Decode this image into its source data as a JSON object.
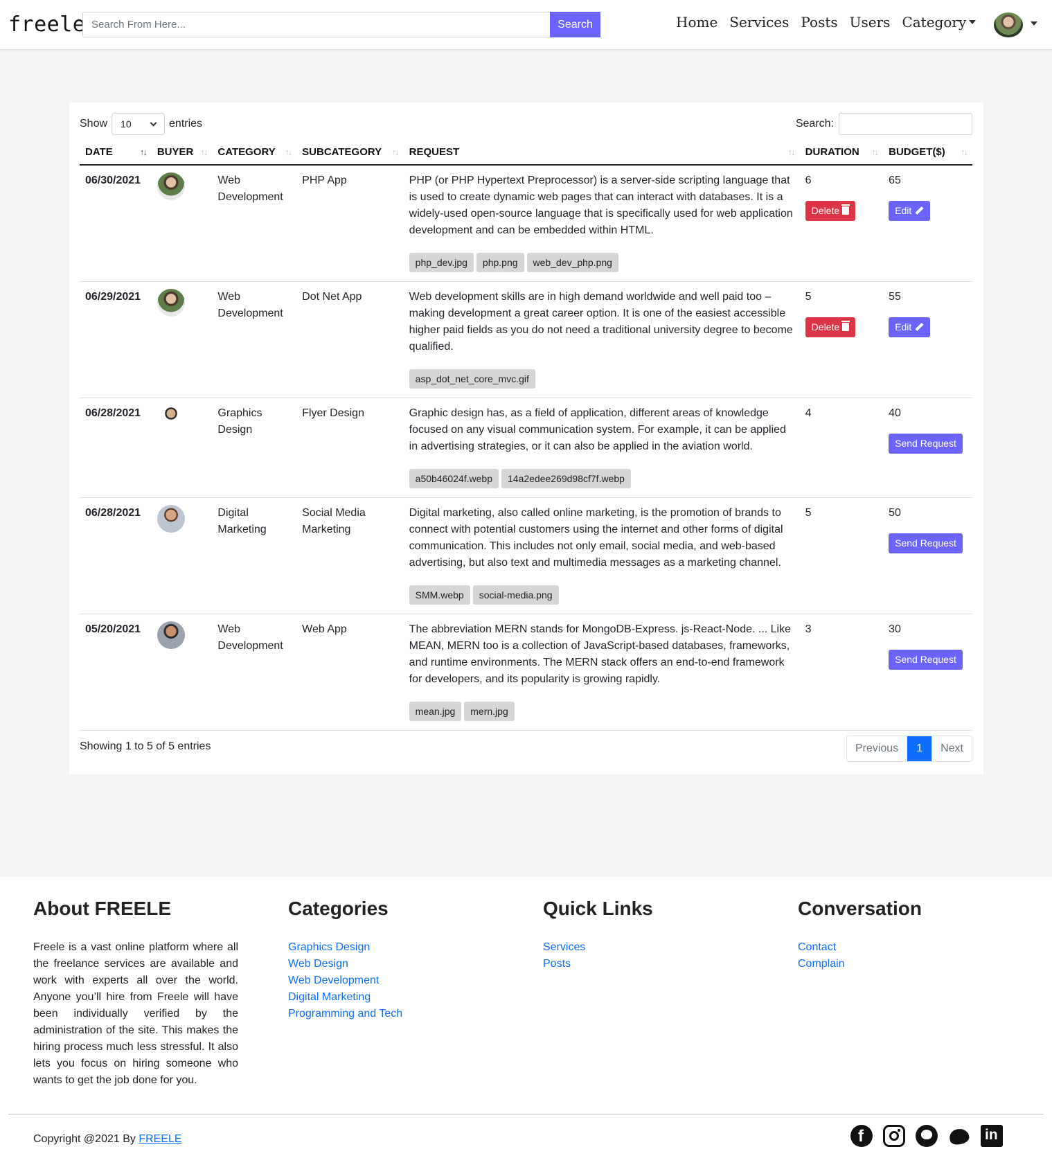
{
  "brand": "freele",
  "search": {
    "placeholder": "Search From Here...",
    "button": "Search"
  },
  "nav": {
    "items": [
      "Home",
      "Services",
      "Posts",
      "Users",
      "Category"
    ]
  },
  "table_controls": {
    "show": "Show",
    "entries_value": "10",
    "entries": "entries",
    "search_label": "Search:"
  },
  "columns": [
    "DATE",
    "BUYER",
    "CATEGORY",
    "SUBCATEGORY",
    "REQUEST",
    "DURATION",
    "BUDGET($)"
  ],
  "rows": [
    {
      "date": "06/30/2021",
      "category": "Web Development",
      "subcategory": "PHP App",
      "request": "PHP (or PHP Hypertext Preprocessor) is a server-side scripting language that is used to create dynamic web pages that can interact with databases. It is a widely-used open-source language that is specifically used for web application development and can be embedded within HTML.",
      "tags": [
        "php_dev.jpg",
        "php.png",
        "web_dev_php.png"
      ],
      "duration": "6",
      "budget": "65",
      "delete": "Delete",
      "action": "Edit"
    },
    {
      "date": "06/29/2021",
      "category": "Web Development",
      "subcategory": "Dot Net App",
      "request": "Web development skills are in high demand worldwide and well paid too – making development a great career option. It is one of the easiest accessible higher paid fields as you do not need a traditional university degree to become qualified.",
      "tags": [
        "asp_dot_net_core_mvc.gif"
      ],
      "duration": "5",
      "budget": "55",
      "delete": "Delete",
      "action": "Edit"
    },
    {
      "date": "06/28/2021",
      "category": "Graphics Design",
      "subcategory": "Flyer Design",
      "request": "Graphic design has, as a field of application, different areas of knowledge focused on any visual communication system. For example, it can be applied in advertising strategies, or it can also be applied in the aviation world.",
      "tags": [
        "a50b46024f.webp",
        "14a2edee269d98cf7f.webp"
      ],
      "duration": "4",
      "budget": "40",
      "action": "Send Request"
    },
    {
      "date": "06/28/2021",
      "category": "Digital Marketing",
      "subcategory": "Social Media Marketing",
      "request": "Digital marketing, also called online marketing, is the promotion of brands to connect with potential customers using the internet and other forms of digital communication. This includes not only email, social media, and web-based advertising, but also text and multimedia messages as a marketing channel.",
      "tags": [
        "SMM.webp",
        "social-media.png"
      ],
      "duration": "5",
      "budget": "50",
      "action": "Send Request"
    },
    {
      "date": "05/20/2021",
      "category": "Web Development",
      "subcategory": "Web App",
      "request": "The abbreviation MERN stands for MongoDB-Express. js-React-Node. ... Like MEAN, MERN too is a collection of JavaScript-based databases, frameworks, and runtime environments. The MERN stack offers an end-to-end framework for developers, and its popularity is growing rapidly.",
      "tags": [
        "mean.jpg",
        "mern.jpg"
      ],
      "duration": "3",
      "budget": "30",
      "action": "Send Request"
    }
  ],
  "info": "Showing 1 to 5 of 5 entries",
  "pagination": {
    "previous": "Previous",
    "current": "1",
    "next": "Next"
  },
  "footer": {
    "about_title": "About FREELE",
    "about_text": "Freele is a vast online platform where all the freelance services are available and work with experts all over the world. Anyone you’ll hire from Freele will have been individually verified by the administration of the site. This makes the hiring process much less stressful. It also lets you focus on hiring someone who wants to get the job done for you.",
    "categories_title": "Categories",
    "categories": [
      "Graphics Design",
      "Web Design",
      "Web Development",
      "Digital Marketing",
      "Programming and Tech"
    ],
    "quick_title": "Quick Links",
    "quick_links": [
      "Services",
      "Posts"
    ],
    "conv_title": "Conversation",
    "conv_links": [
      "Contact",
      "Complain"
    ],
    "copyright": "Copyright @2021 By",
    "copyright_link": "FREELE",
    "socials": [
      "facebook-icon",
      "instagram-icon",
      "github-icon",
      "twitter-icon",
      "linkedin-icon"
    ]
  }
}
